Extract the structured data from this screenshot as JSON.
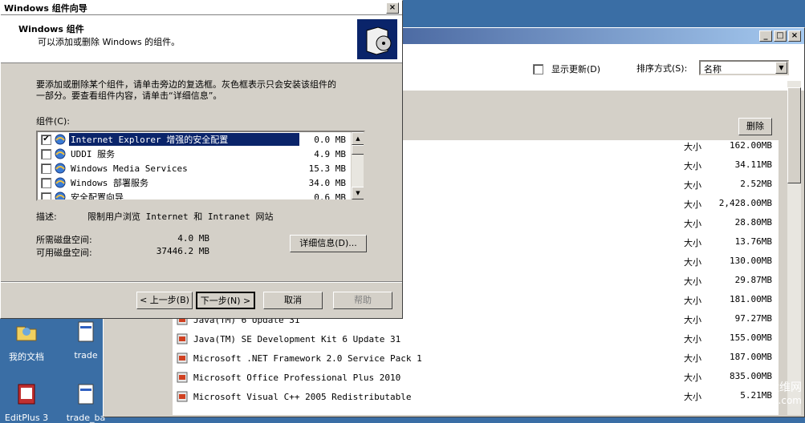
{
  "desktop": {
    "icons": [
      {
        "label": "我的文档",
        "icon": "folder-documents-icon"
      },
      {
        "label": "trade",
        "icon": "notepad-file-icon"
      },
      {
        "label": "EditPlus 3",
        "icon": "editplus-icon"
      },
      {
        "label": "trade_ba",
        "icon": "notepad-file-icon"
      }
    ]
  },
  "bgwindow": {
    "show_updates_label": "显示更新(D)",
    "sort_label": "排序方式(S):",
    "sort_value": "名称",
    "delete_button": "删除",
    "size_label": "大小",
    "sizes": [
      "162.00MB",
      "34.11MB",
      "2.52MB",
      "2,428.00MB",
      "28.80MB",
      "13.76MB",
      "130.00MB",
      "29.87MB",
      "181.00MB",
      "97.27MB",
      "155.00MB",
      "187.00MB",
      "835.00MB",
      "5.21MB"
    ],
    "programs": [
      {
        "name": "Java(TM) 6 Update 31",
        "icon": "java-icon"
      },
      {
        "name": "Java(TM) SE Development Kit 6 Update 31",
        "icon": "java-icon"
      },
      {
        "name": "Microsoft .NET Framework 2.0 Service Pack 1",
        "icon": "installer-icon"
      },
      {
        "name": "Microsoft Office Professional Plus 2010",
        "icon": "office-icon"
      },
      {
        "name": "Microsoft Visual C++ 2005 Redistributable",
        "icon": "installer-icon"
      }
    ]
  },
  "wizard": {
    "title": "Windows 组件向导",
    "header_title": "Windows 组件",
    "header_subtitle": "可以添加或删除 Windows 的组件。",
    "description_line1": "要添加或删除某个组件，请单击旁边的复选框。灰色框表示只会安装该组件的",
    "description_line2": "一部分。要查看组件内容，请单击“详细信息”。",
    "components_label": "组件(C):",
    "components": [
      {
        "name": "Internet Explorer 增强的安全配置",
        "size": "0.0 MB",
        "checked": true,
        "icon": "ie-icon"
      },
      {
        "name": "UDDI 服务",
        "size": "4.9 MB",
        "checked": false,
        "icon": "globe-icon"
      },
      {
        "name": "Windows Media Services",
        "size": "15.3 MB",
        "checked": false,
        "icon": "media-services-icon"
      },
      {
        "name": "Windows 部署服务",
        "size": "34.0 MB",
        "checked": false,
        "icon": "computer-icon"
      },
      {
        "name": "安全配置向导",
        "size": "0.6 MB",
        "checked": false,
        "icon": "security-icon"
      }
    ],
    "desc_label": "描述:",
    "desc_value": "限制用户浏览 Internet 和 Intranet 网站",
    "required_label": "所需磁盘空间:",
    "required_value": "4.0 MB",
    "available_label": "可用磁盘空间:",
    "available_value": "37446.2 MB",
    "details_button": "详细信息(D)...",
    "back_button": "< 上一步(B)",
    "next_button": "下一步(N) >",
    "cancel_button": "取消",
    "help_button": "帮助"
  },
  "watermark": {
    "text1": "运维网",
    "text2": "iyunv.com"
  }
}
